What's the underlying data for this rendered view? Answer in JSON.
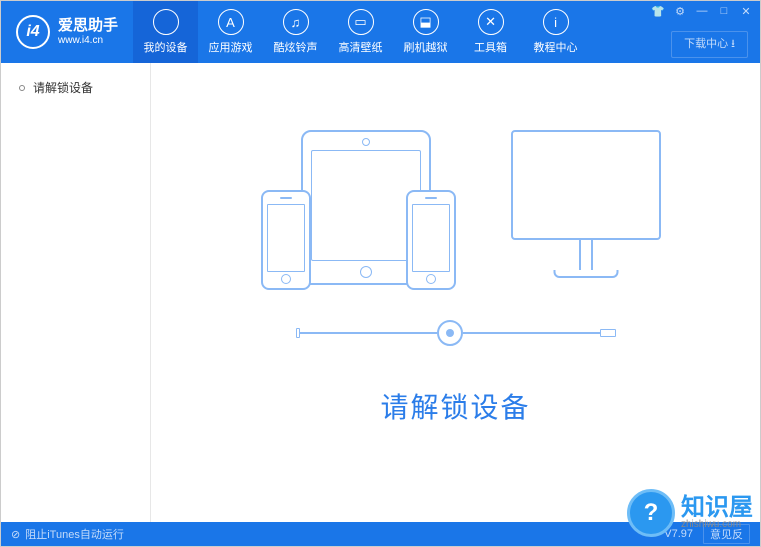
{
  "app": {
    "name": "爱思助手",
    "url": "www.i4.cn",
    "logo": "i4"
  },
  "nav": {
    "items": [
      {
        "label": "我的设备",
        "icon": "apple"
      },
      {
        "label": "应用游戏",
        "icon": "appstore"
      },
      {
        "label": "酷炫铃声",
        "icon": "bell"
      },
      {
        "label": "高清壁纸",
        "icon": "image"
      },
      {
        "label": "刷机越狱",
        "icon": "box"
      },
      {
        "label": "工具箱",
        "icon": "tools"
      },
      {
        "label": "教程中心",
        "icon": "info"
      }
    ],
    "download_center": "下载中心"
  },
  "sidebar": {
    "items": [
      {
        "label": "请解锁设备"
      }
    ]
  },
  "content": {
    "message": "请解锁设备"
  },
  "statusbar": {
    "block_itunes": "阻止iTunes自动运行",
    "version": "V7.97",
    "feedback": "意见反"
  },
  "watermark": {
    "title": "知识屋",
    "url": "zhishiwu.com",
    "mark": "?"
  }
}
